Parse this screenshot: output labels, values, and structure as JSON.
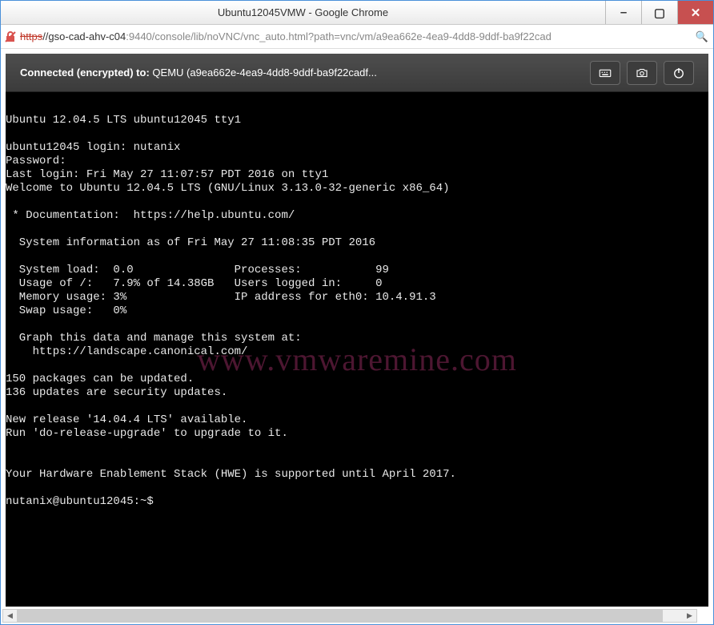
{
  "window": {
    "title": "Ubuntu12045VMW - Google Chrome",
    "buttons": {
      "min": "–",
      "max": "▢",
      "close": "✕"
    }
  },
  "address": {
    "protocol_struck": "https",
    "host": "//gso-cad-ahv-c04",
    "port": ":9440",
    "path": "/console/lib/noVNC/vnc_auto.html?path=vnc/vm/a9ea662e-4ea9-4dd8-9ddf-ba9f22cad"
  },
  "vnc": {
    "status_prefix": "Connected (encrypted) to: ",
    "status_target": "QEMU (a9ea662e-4ea9-4dd8-9ddf-ba9f22cadf...",
    "btn_keys": "keyboard-icon",
    "btn_screenshot": "camera-icon",
    "btn_power": "power-icon"
  },
  "terminal": {
    "lines": [
      "",
      "Ubuntu 12.04.5 LTS ubuntu12045 tty1",
      "",
      "ubuntu12045 login: nutanix",
      "Password:",
      "Last login: Fri May 27 11:07:57 PDT 2016 on tty1",
      "Welcome to Ubuntu 12.04.5 LTS (GNU/Linux 3.13.0-32-generic x86_64)",
      "",
      " * Documentation:  https://help.ubuntu.com/",
      "",
      "  System information as of Fri May 27 11:08:35 PDT 2016",
      "",
      "  System load:  0.0               Processes:           99",
      "  Usage of /:   7.9% of 14.38GB   Users logged in:     0",
      "  Memory usage: 3%                IP address for eth0: 10.4.91.3",
      "  Swap usage:   0%",
      "",
      "  Graph this data and manage this system at:",
      "    https://landscape.canonical.com/",
      "",
      "150 packages can be updated.",
      "136 updates are security updates.",
      "",
      "New release '14.04.4 LTS' available.",
      "Run 'do-release-upgrade' to upgrade to it.",
      "",
      "",
      "Your Hardware Enablement Stack (HWE) is supported until April 2017.",
      "",
      "nutanix@ubuntu12045:~$"
    ]
  },
  "watermark": "www.vmwaremine.com"
}
